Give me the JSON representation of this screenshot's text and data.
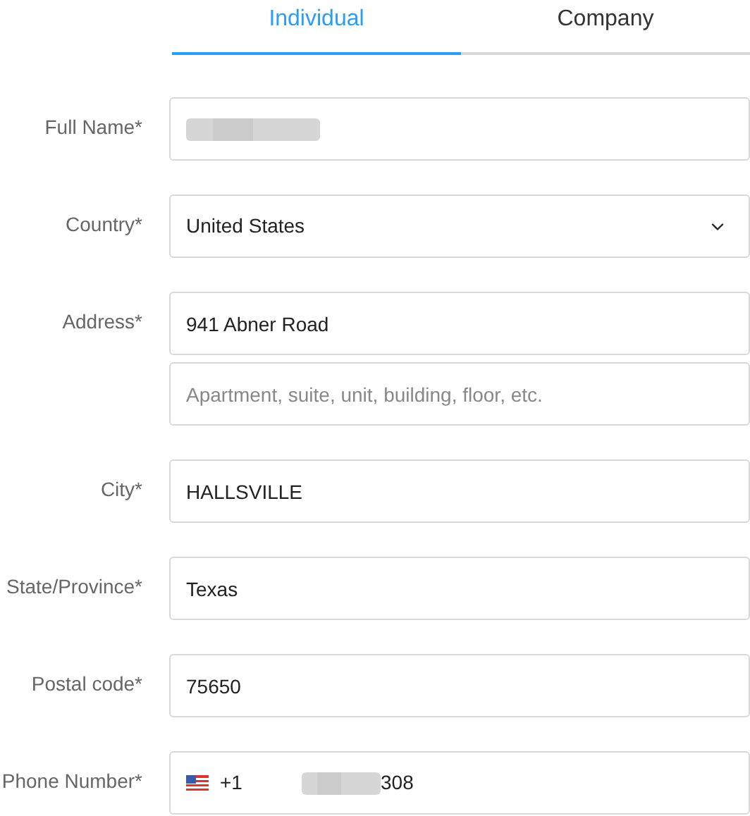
{
  "tabs": [
    {
      "label": "Individual",
      "selected": true
    },
    {
      "label": "Company",
      "selected": false
    }
  ],
  "fields": [
    {
      "label": "Full Name*",
      "kind": "text",
      "inputs": [
        {
          "redacted": true
        }
      ]
    },
    {
      "label": "Country*",
      "kind": "select",
      "inputs": [
        {
          "value": "United States"
        }
      ]
    },
    {
      "label": "Address*",
      "kind": "text",
      "inputs": [
        {
          "value": "941 Abner Road"
        },
        {
          "placeholder": "Apartment, suite, unit, building, floor, etc."
        }
      ]
    },
    {
      "label": "City*",
      "kind": "text",
      "inputs": [
        {
          "value": "HALLSVILLE"
        }
      ]
    },
    {
      "label": "State/Province*",
      "kind": "text",
      "inputs": [
        {
          "value": "Texas"
        }
      ]
    },
    {
      "label": "Postal code*",
      "kind": "text",
      "inputs": [
        {
          "value": "75650"
        }
      ]
    },
    {
      "label": "Phone Number*",
      "kind": "phone",
      "inputs": [
        {
          "prefix": "+1",
          "value": "308",
          "redacted": true
        }
      ]
    }
  ]
}
